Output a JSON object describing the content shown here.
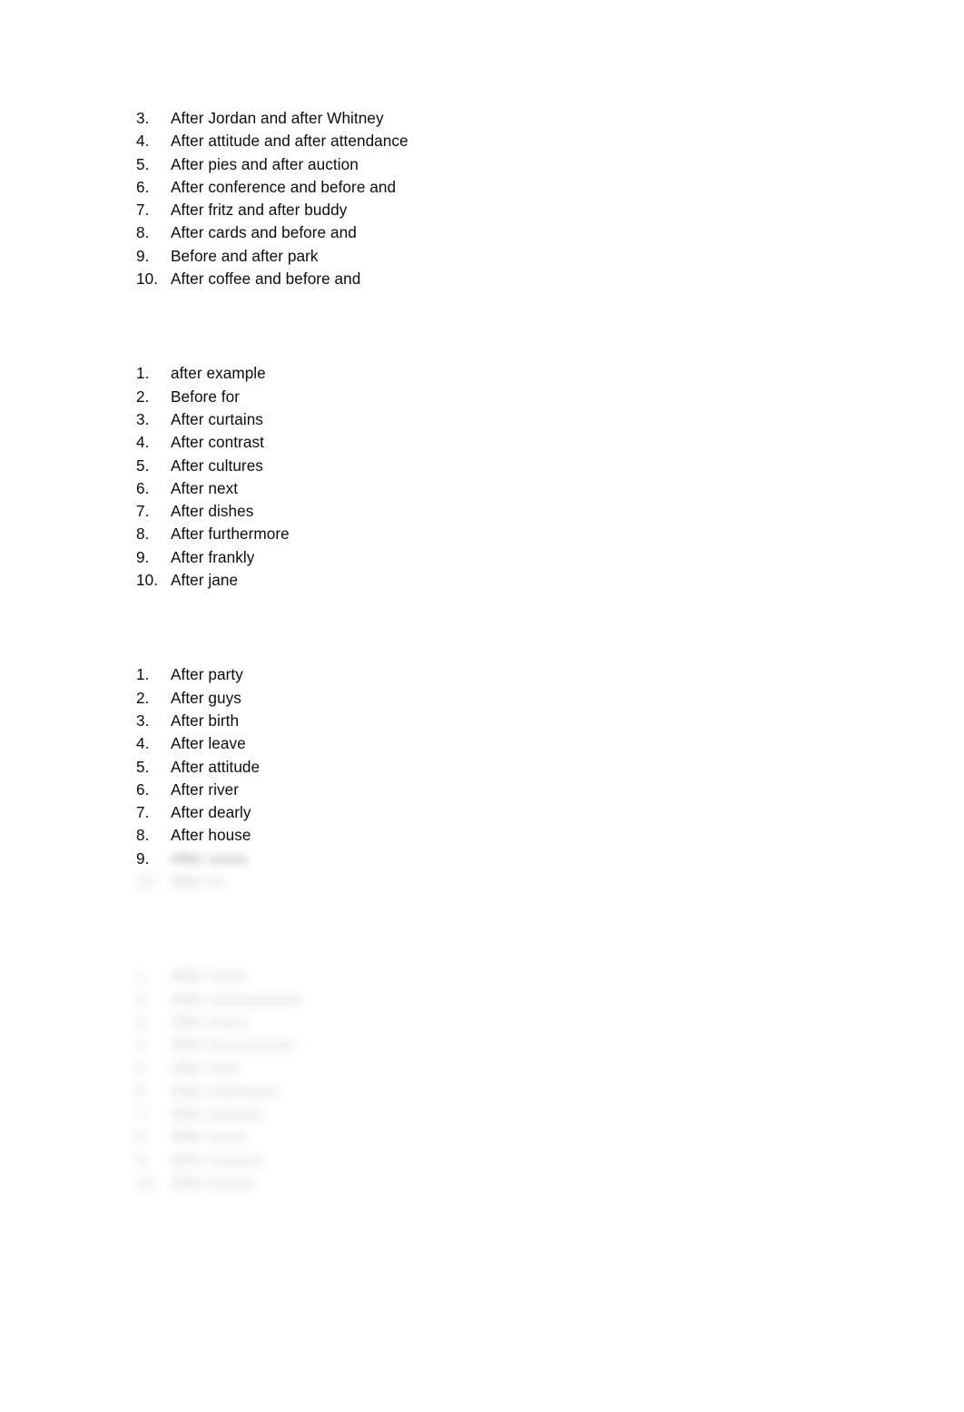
{
  "document": {
    "background_color": "#ffffff",
    "text_color": "#0d0d0d",
    "blurred_note": "Lower portions of the page are blurred and illegible"
  },
  "blocks": [
    {
      "id": "list-block-1",
      "blurred": false,
      "items": [
        {
          "number": "3.",
          "text": "After Jordan and after Whitney",
          "blurred": false
        },
        {
          "number": "4.",
          "text": "After attitude and after attendance",
          "blurred": false
        },
        {
          "number": "5.",
          "text": "After pies and after auction",
          "blurred": false
        },
        {
          "number": "6.",
          "text": "After conference and before and",
          "blurred": false
        },
        {
          "number": "7.",
          "text": "After fritz and after buddy",
          "blurred": false
        },
        {
          "number": "8.",
          "text": "After cards and before and",
          "blurred": false
        },
        {
          "number": "9.",
          "text": "Before and after park",
          "blurred": false
        },
        {
          "number": "10.",
          "text": "After coffee and before and",
          "blurred": false
        }
      ]
    },
    {
      "id": "list-block-2",
      "blurred": false,
      "items": [
        {
          "number": "1.",
          "text": "after example",
          "blurred": false
        },
        {
          "number": "2.",
          "text": "Before for",
          "blurred": false
        },
        {
          "number": "3.",
          "text": "After curtains",
          "blurred": false
        },
        {
          "number": "4.",
          "text": "After contrast",
          "blurred": false
        },
        {
          "number": "5.",
          "text": "After cultures",
          "blurred": false
        },
        {
          "number": "6.",
          "text": "After next",
          "blurred": false
        },
        {
          "number": "7.",
          "text": "After dishes",
          "blurred": false
        },
        {
          "number": "8.",
          "text": "After furthermore",
          "blurred": false
        },
        {
          "number": "9.",
          "text": "After frankly",
          "blurred": false
        },
        {
          "number": "10.",
          "text": "After jane",
          "blurred": false
        }
      ]
    },
    {
      "id": "list-block-3",
      "blurred": false,
      "items": [
        {
          "number": "1.",
          "text": "After party",
          "blurred": false
        },
        {
          "number": "2.",
          "text": "After guys",
          "blurred": false
        },
        {
          "number": "3.",
          "text": "After birth",
          "blurred": false
        },
        {
          "number": "4.",
          "text": "After leave",
          "blurred": false
        },
        {
          "number": "5.",
          "text": "After attitude",
          "blurred": false
        },
        {
          "number": "6.",
          "text": "After river",
          "blurred": false
        },
        {
          "number": "7.",
          "text": "After dearly",
          "blurred": false
        },
        {
          "number": "8.",
          "text": "After house",
          "blurred": false
        },
        {
          "number": "9.",
          "text": "After xxxxx",
          "blurred": true
        },
        {
          "number": "10.",
          "text": "After xx",
          "blurred": true,
          "number_blurred": true
        }
      ]
    },
    {
      "id": "list-block-4",
      "blurred": true,
      "items": [
        {
          "number": "1.",
          "text": "After xxxxx",
          "blurred": true
        },
        {
          "number": "2.",
          "text": "After xxxxxxxxxxxx",
          "blurred": true
        },
        {
          "number": "3.",
          "text": "After xxxxx",
          "blurred": true
        },
        {
          "number": "4.",
          "text": "After xxxxxxxxxxx",
          "blurred": true
        },
        {
          "number": "5.",
          "text": "After xxxx",
          "blurred": true
        },
        {
          "number": "6.",
          "text": "After xxxxxxxxx",
          "blurred": true
        },
        {
          "number": "7.",
          "text": "After xxxxxxx",
          "blurred": true
        },
        {
          "number": "8.",
          "text": "After xxxxx",
          "blurred": true
        },
        {
          "number": "9.",
          "text": "After xxxxxxx",
          "blurred": true
        },
        {
          "number": "10.",
          "text": "After xxxxxx",
          "blurred": true
        }
      ]
    }
  ]
}
